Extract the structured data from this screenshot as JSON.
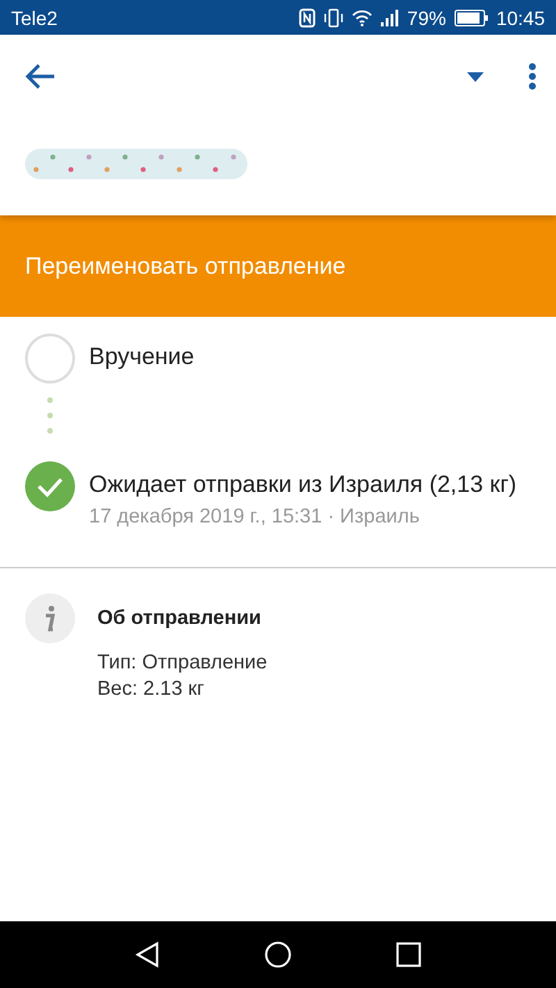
{
  "status_bar": {
    "carrier": "Tele2",
    "battery": "79%",
    "time": "10:45"
  },
  "banner": {
    "label": "Переименовать отправление"
  },
  "timeline": [
    {
      "title": "Вручение",
      "completed": false
    },
    {
      "title": "Ожидает отправки из Израиля (2,13 кг)",
      "subtitle": "17 декабря 2019 г., 15:31 · Израиль",
      "completed": true
    }
  ],
  "info": {
    "heading": "Об отправлении",
    "lines": [
      "Тип: Отправление",
      "Вес: 2.13 кг"
    ]
  }
}
